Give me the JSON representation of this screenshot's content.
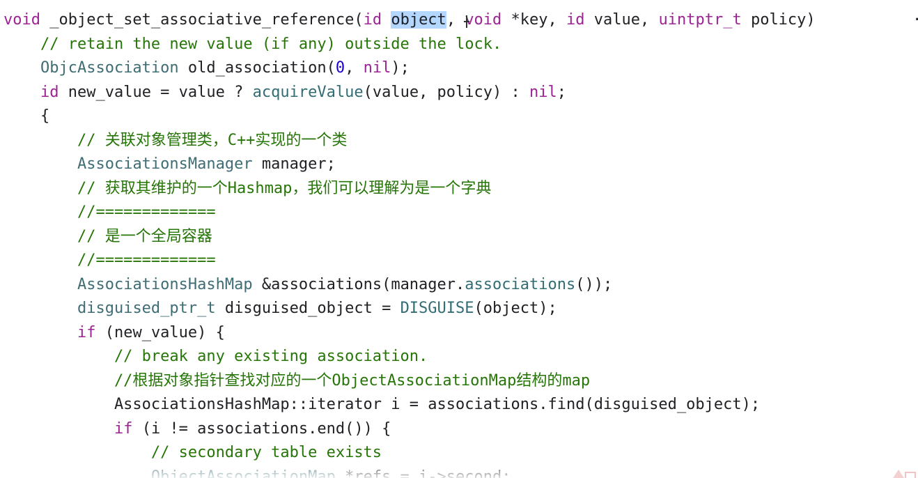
{
  "editor": {
    "lines": [
      {
        "tokens": [
          {
            "t": "void",
            "c": "keyword"
          },
          {
            "t": " _object_set_associative_reference(",
            "c": "plain"
          },
          {
            "t": "id",
            "c": "keyword"
          },
          {
            "t": " ",
            "c": "plain"
          },
          {
            "t": "object",
            "c": "selected"
          },
          {
            "t": ", ",
            "c": "plain"
          },
          {
            "t": "void",
            "c": "keyword"
          },
          {
            "t": " *key, ",
            "c": "plain"
          },
          {
            "t": "id",
            "c": "keyword"
          },
          {
            "t": " value, ",
            "c": "plain"
          },
          {
            "t": "uintptr_t",
            "c": "keyword"
          },
          {
            "t": " policy) ",
            "c": "plain"
          }
        ]
      },
      {
        "tokens": [
          {
            "t": "    // retain the new value (if any) outside the lock.",
            "c": "comment"
          }
        ]
      },
      {
        "tokens": [
          {
            "t": "    ",
            "c": "plain"
          },
          {
            "t": "ObjcAssociation",
            "c": "type"
          },
          {
            "t": " old_association(",
            "c": "plain"
          },
          {
            "t": "0",
            "c": "number"
          },
          {
            "t": ", ",
            "c": "plain"
          },
          {
            "t": "nil",
            "c": "keyword"
          },
          {
            "t": ");",
            "c": "plain"
          }
        ]
      },
      {
        "tokens": [
          {
            "t": "    ",
            "c": "plain"
          },
          {
            "t": "id",
            "c": "keyword"
          },
          {
            "t": " new_value = value ? ",
            "c": "plain"
          },
          {
            "t": "acquireValue",
            "c": "func"
          },
          {
            "t": "(value, policy) : ",
            "c": "plain"
          },
          {
            "t": "nil",
            "c": "keyword"
          },
          {
            "t": ";",
            "c": "plain"
          }
        ]
      },
      {
        "tokens": [
          {
            "t": "    {",
            "c": "plain"
          }
        ]
      },
      {
        "tokens": [
          {
            "t": "        // 关联对象管理类，C++实现的一个类",
            "c": "comment"
          }
        ]
      },
      {
        "tokens": [
          {
            "t": "        ",
            "c": "plain"
          },
          {
            "t": "AssociationsManager",
            "c": "type"
          },
          {
            "t": " manager;",
            "c": "plain"
          }
        ]
      },
      {
        "tokens": [
          {
            "t": "        // 获取其维护的一个Hashmap，我们可以理解为是一个字典",
            "c": "comment"
          }
        ]
      },
      {
        "tokens": [
          {
            "t": "        //=============",
            "c": "comment"
          }
        ]
      },
      {
        "tokens": [
          {
            "t": "        // 是一个全局容器",
            "c": "comment"
          }
        ]
      },
      {
        "tokens": [
          {
            "t": "        //=============",
            "c": "comment"
          }
        ]
      },
      {
        "tokens": [
          {
            "t": "        ",
            "c": "plain"
          },
          {
            "t": "AssociationsHashMap",
            "c": "type"
          },
          {
            "t": " &associations(manager.",
            "c": "plain"
          },
          {
            "t": "associations",
            "c": "func"
          },
          {
            "t": "());",
            "c": "plain"
          }
        ]
      },
      {
        "tokens": [
          {
            "t": "        ",
            "c": "plain"
          },
          {
            "t": "disguised_ptr_t",
            "c": "type"
          },
          {
            "t": " disguised_object = ",
            "c": "plain"
          },
          {
            "t": "DISGUISE",
            "c": "func"
          },
          {
            "t": "(object);",
            "c": "plain"
          }
        ]
      },
      {
        "tokens": [
          {
            "t": "        ",
            "c": "plain"
          },
          {
            "t": "if",
            "c": "keyword"
          },
          {
            "t": " (new_value) {",
            "c": "plain"
          }
        ]
      },
      {
        "tokens": [
          {
            "t": "            // break any existing association.",
            "c": "comment"
          }
        ]
      },
      {
        "tokens": [
          {
            "t": "            //根据对象指针查找对应的一个ObjectAssociationMap结构的map",
            "c": "comment"
          }
        ]
      },
      {
        "tokens": [
          {
            "t": "            AssociationsHashMap::iterator i = associations.find(disguised_object);",
            "c": "plain"
          }
        ]
      },
      {
        "tokens": [
          {
            "t": "            ",
            "c": "plain"
          },
          {
            "t": "if",
            "c": "keyword"
          },
          {
            "t": " (i != associations.end()) {",
            "c": "plain"
          }
        ]
      },
      {
        "tokens": [
          {
            "t": "                // secondary table exists",
            "c": "comment"
          }
        ]
      },
      {
        "tokens": [
          {
            "t": "                ",
            "c": "plain"
          },
          {
            "t": "ObjectAssociationMap",
            "c": "type"
          },
          {
            "t": " *refs = i->second;",
            "c": "plain"
          }
        ]
      }
    ],
    "overflow_glyph": "·"
  }
}
